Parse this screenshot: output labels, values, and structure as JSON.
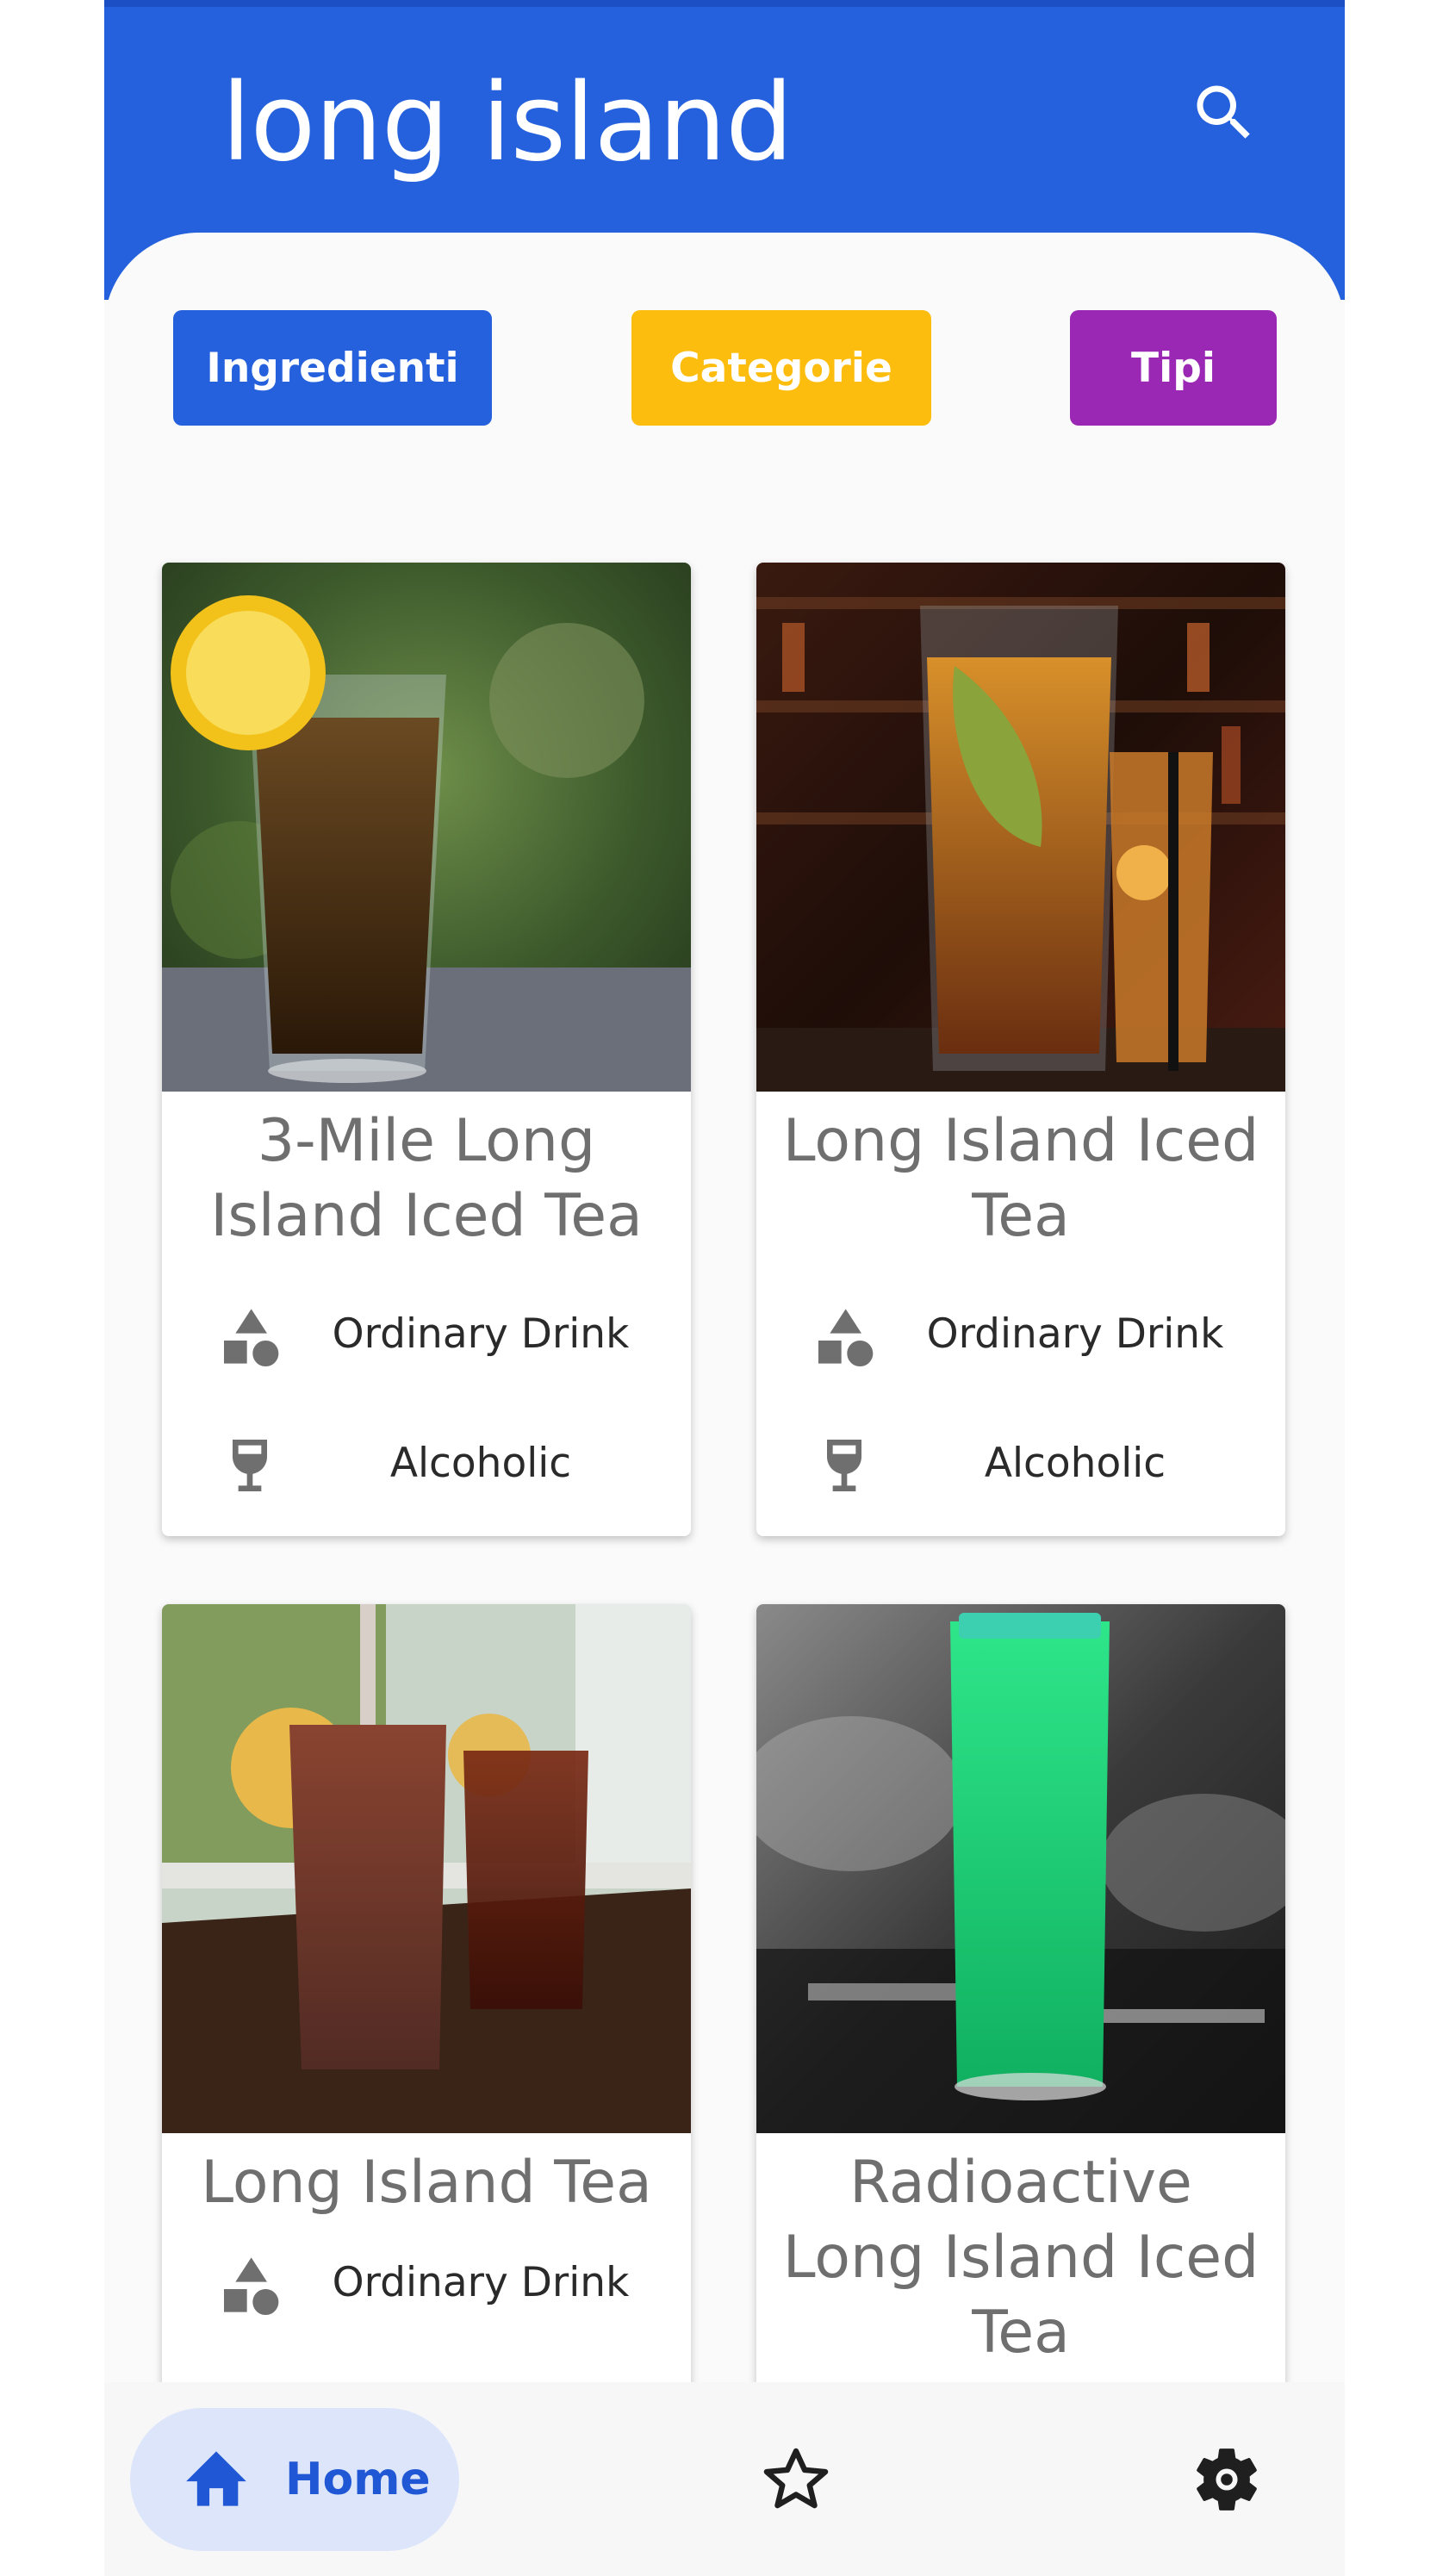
{
  "app_bar": {
    "title": "long island",
    "search_icon": "search-icon"
  },
  "filters": {
    "ingredienti": "Ingredienti",
    "categorie": "Categorie",
    "tipi": "Tipi",
    "colors": {
      "ingredienti": "#2561dc",
      "categorie": "#fdbd0e",
      "tipi": "#9a28b4"
    }
  },
  "drinks": [
    {
      "name": "3-Mile Long Island Iced Tea",
      "category": "Ordinary Drink",
      "type": "Alcoholic"
    },
    {
      "name": "Long Island Iced Tea",
      "category": "Ordinary Drink",
      "type": "Alcoholic"
    },
    {
      "name": "Long Island Tea",
      "category": "Ordinary Drink"
    },
    {
      "name": "Radioactive Long Island Iced Tea"
    }
  ],
  "icons": {
    "category": "shapes-icon",
    "type": "wine-glass-icon",
    "home": "home-icon",
    "favorites": "star-outline-icon",
    "settings": "gear-icon"
  },
  "bottom_nav": {
    "home_label": "Home",
    "active": "Home"
  },
  "colors": {
    "primary": "#2561dc",
    "nav_active_bg": "#dde5fb",
    "text_muted": "#6f6f6f"
  }
}
